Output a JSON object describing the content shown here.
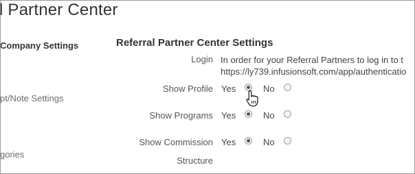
{
  "page": {
    "title": "l Partner Center"
  },
  "sidebar": {
    "items": [
      {
        "label": "Company Settings",
        "active": true
      },
      {
        "label": "pt/Note Settings",
        "active": false
      },
      {
        "label": "gories",
        "active": false
      }
    ]
  },
  "main": {
    "section_title": "Referral Partner Center Settings",
    "login": {
      "label": "Login",
      "text_line1": "In order for your Referral Partners to log in to t",
      "text_line2": "https://ly739.infusionsoft.com/app/authenticatio"
    },
    "rows": [
      {
        "label": "Show Profile",
        "yes": "Yes",
        "no": "No",
        "selected": "yes"
      },
      {
        "label": "Show Programs",
        "yes": "Yes",
        "no": "No",
        "selected": "yes"
      },
      {
        "label_line1": "Show Commission",
        "label_line2": "Structure",
        "yes": "Yes",
        "no": "No",
        "selected": "yes"
      }
    ]
  },
  "icons": {
    "cursor": "hand-pointer-icon"
  }
}
